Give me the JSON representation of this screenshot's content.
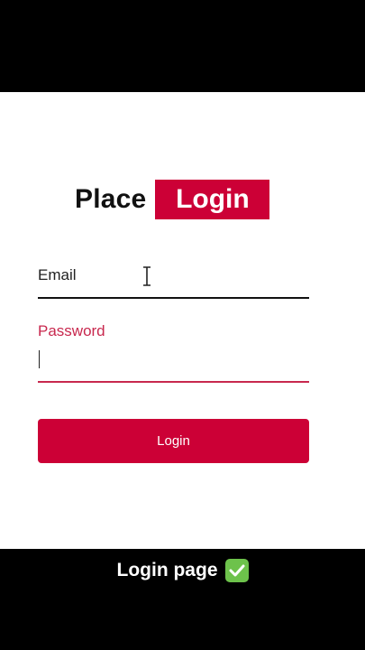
{
  "logo": {
    "word1": "Place",
    "word2": "Login"
  },
  "form": {
    "email_label": "Email",
    "email_value": "",
    "password_label": "Password",
    "password_value": "",
    "submit_label": "Login"
  },
  "caption": {
    "text": "Login page",
    "icon": "check-mark-icon"
  },
  "colors": {
    "accent": "#cc0036",
    "focus": "#c8284e",
    "background": "#ffffff",
    "frame": "#000000"
  }
}
